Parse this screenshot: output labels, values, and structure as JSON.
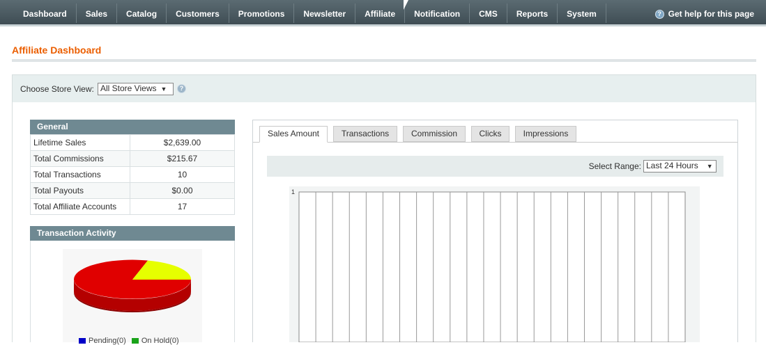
{
  "nav": {
    "items": [
      "Dashboard",
      "Sales",
      "Catalog",
      "Customers",
      "Promotions",
      "Newsletter",
      "Affiliate",
      "Notification",
      "CMS",
      "Reports",
      "System"
    ],
    "help_label": "Get help for this page"
  },
  "page": {
    "title": "Affiliate Dashboard"
  },
  "store_view": {
    "label": "Choose Store View:",
    "selected": "All Store Views"
  },
  "general": {
    "title": "General",
    "rows": [
      {
        "label": "Lifetime Sales",
        "value": "$2,639.00"
      },
      {
        "label": "Total Commissions",
        "value": "$215.67"
      },
      {
        "label": "Total Transactions",
        "value": "10"
      },
      {
        "label": "Total Payouts",
        "value": "$0.00"
      },
      {
        "label": "Total Affiliate Accounts",
        "value": "17"
      }
    ]
  },
  "transaction_activity": {
    "title": "Transaction Activity",
    "legend": [
      {
        "label": "Pending(0)",
        "color": "#0000c8"
      },
      {
        "label": "On Hold(0)",
        "color": "#1aa31a"
      }
    ]
  },
  "tabs": [
    "Sales Amount",
    "Transactions",
    "Commission",
    "Clicks",
    "Impressions"
  ],
  "range": {
    "label": "Select Range:",
    "selected": "Last 24 Hours"
  },
  "chart_data": {
    "type": "line",
    "title": "",
    "ylim": [
      0,
      1
    ],
    "y_ticks": [
      "1"
    ],
    "grid": true,
    "series": []
  },
  "colors": {
    "nav_bg": "#4a5a61",
    "title_orange": "#eb5e00",
    "box_head": "#6f8992",
    "pie_red": "#e00000",
    "pie_yellow": "#e6ff00"
  }
}
